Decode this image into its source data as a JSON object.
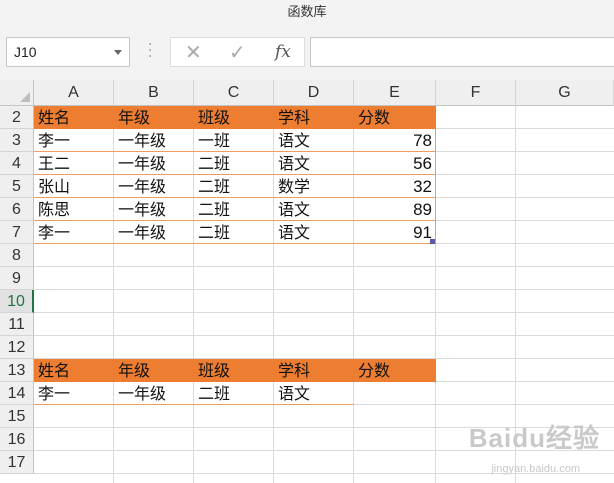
{
  "window": {
    "title": "函数库"
  },
  "formula_bar": {
    "name_box": "J10",
    "cancel_glyph": "✕",
    "enter_glyph": "✓",
    "fx_label": "fx",
    "formula": ""
  },
  "columns": [
    "A",
    "B",
    "C",
    "D",
    "E",
    "F",
    "G"
  ],
  "rows": [
    "2",
    "3",
    "4",
    "5",
    "6",
    "7",
    "8",
    "9",
    "10",
    "11",
    "12",
    "13",
    "14",
    "15",
    "16",
    "17"
  ],
  "selected_row": "10",
  "table1": {
    "headers": [
      "姓名",
      "年级",
      "班级",
      "学科",
      "分数"
    ],
    "rows": [
      [
        "李一",
        "一年级",
        "一班",
        "语文",
        "78"
      ],
      [
        "王二",
        "一年级",
        "二班",
        "语文",
        "56"
      ],
      [
        "张山",
        "一年级",
        "二班",
        "数学",
        "32"
      ],
      [
        "陈思",
        "一年级",
        "二班",
        "语文",
        "89"
      ],
      [
        "李一",
        "一年级",
        "二班",
        "语文",
        "91"
      ]
    ]
  },
  "table2": {
    "headers": [
      "姓名",
      "年级",
      "班级",
      "学科",
      "分数"
    ],
    "rows": [
      [
        "李一",
        "一年级",
        "二班",
        "语文",
        ""
      ]
    ]
  },
  "colors": {
    "header_fill": "#ed7d31",
    "border": "#ed9d63",
    "select": "#217346"
  },
  "watermark": {
    "text": "Baidu经验",
    "sub": "jingyan.baidu.com"
  }
}
